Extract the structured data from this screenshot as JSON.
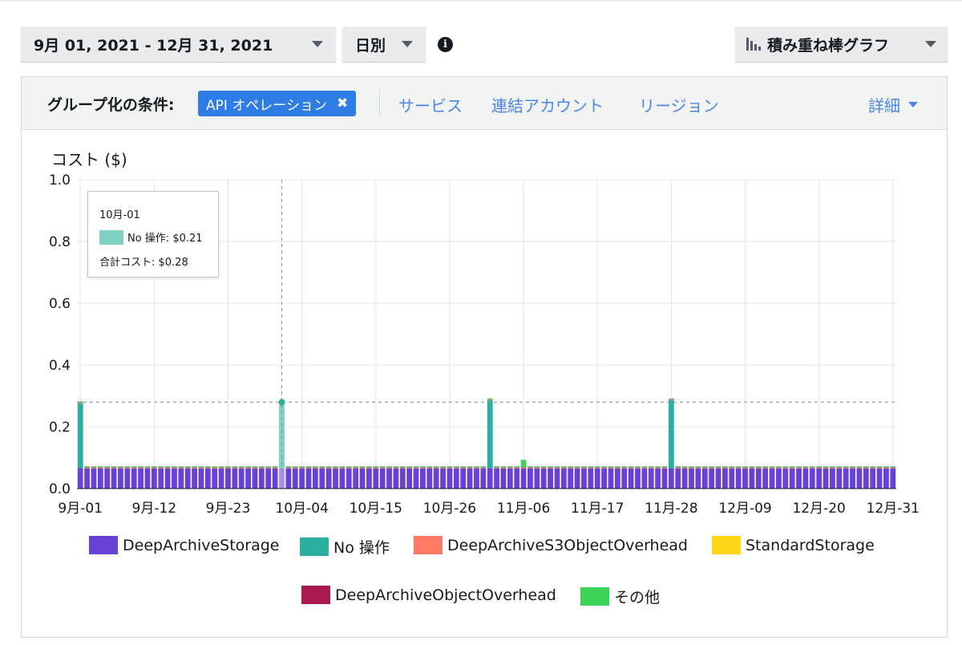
{
  "toolbar": {
    "date_range": "9月 01, 2021 - 12月 31, 2021",
    "granularity": "日別",
    "chart_type": "積み重ね棒グラフ"
  },
  "group_by": {
    "label": "グループ化の条件:",
    "selected": "API オペレーション",
    "options": [
      "サービス",
      "連結アカウント",
      "リージョン"
    ],
    "more": "詳細"
  },
  "tooltip": {
    "date": "10月-01",
    "series_line": "No 操作: $0.21",
    "total_line": "合計コスト: $0.28"
  },
  "colors": {
    "DeepArchiveStorage": "#6842d4",
    "No 操作": "#2ab09e",
    "DeepArchiveS3ObjectOverhead": "#ff7a64",
    "StandardStorage": "#ffd515",
    "DeepArchiveObjectOverhead": "#a8194f",
    "その他": "#3bd459"
  },
  "chart_data": {
    "type": "bar",
    "stacked": true,
    "ylabel": "コスト ($)",
    "ylim": [
      0,
      1.0
    ],
    "yticks": [
      "0.0",
      "0.2",
      "0.4",
      "0.6",
      "0.8",
      "1.0"
    ],
    "xticks": [
      "9月-01",
      "9月-12",
      "9月-23",
      "10月-04",
      "10月-15",
      "10月-26",
      "11月-06",
      "11月-17",
      "11月-28",
      "12月-09",
      "12月-20",
      "12月-31"
    ],
    "grid": true,
    "legend_position": "bottom",
    "x_start": "9月-01",
    "x_end": "12月-31",
    "day_count": 122,
    "series": [
      {
        "name": "DeepArchiveStorage",
        "default": 0.066,
        "overrides": {}
      },
      {
        "name": "No 操作",
        "default": 0,
        "overrides": {
          "0": 0.21,
          "30": 0.21,
          "61": 0.22,
          "88": 0.22
        }
      },
      {
        "name": "DeepArchiveS3ObjectOverhead",
        "default": 0.001,
        "overrides": {}
      },
      {
        "name": "StandardStorage",
        "default": 0.001,
        "overrides": {}
      },
      {
        "name": "DeepArchiveObjectOverhead",
        "default": 0.001,
        "overrides": {}
      },
      {
        "name": "その他",
        "default": 0.003,
        "overrides": {
          "66": 0.024
        }
      }
    ],
    "total_reference": 0.28,
    "highlight_index": 30
  }
}
